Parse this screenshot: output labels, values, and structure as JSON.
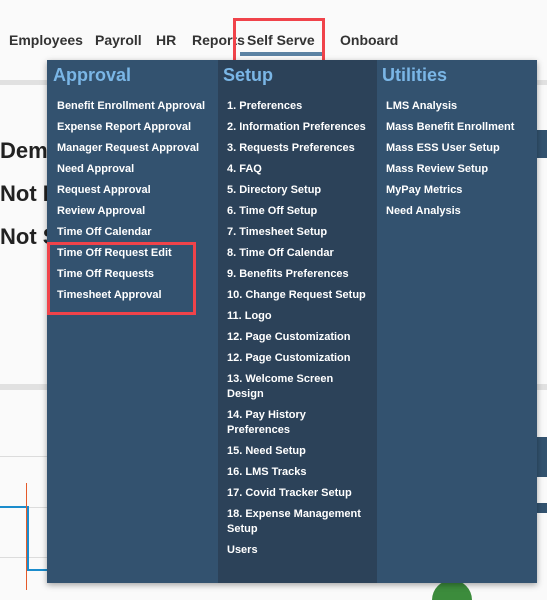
{
  "nav": {
    "items": [
      {
        "label": "Employees"
      },
      {
        "label": "Payroll"
      },
      {
        "label": "HR"
      },
      {
        "label": "Reports"
      },
      {
        "label": "Self Serve",
        "active": true
      },
      {
        "label": "Onboard"
      }
    ]
  },
  "background": {
    "headings": [
      "Demo",
      "Not P",
      "Not S"
    ]
  },
  "menu": {
    "approval": {
      "title": "Approval",
      "items": [
        "Benefit Enrollment Approval",
        "Expense Report Approval",
        "Manager Request Approval",
        "Need Approval",
        "Request Approval",
        "Review Approval",
        "Time Off Calendar",
        "Time Off Request Edit",
        "Time Off Requests",
        "Timesheet Approval"
      ]
    },
    "setup": {
      "title": "Setup",
      "items": [
        "1. Preferences",
        "2. Information Preferences",
        "3. Requests Preferences",
        "4. FAQ",
        "5. Directory Setup",
        "6. Time Off Setup",
        "7. Timesheet Setup",
        "8. Time Off Calendar",
        "9. Benefits Preferences",
        "10. Change Request Setup",
        "11. Logo",
        "12. Page Customization",
        "12. Page Customization",
        "13. Welcome Screen Design",
        "14. Pay History Preferences",
        "15. Need Setup",
        "16. LMS Tracks",
        "17. Covid Tracker Setup",
        "18. Expense Management Setup",
        "Users"
      ]
    },
    "utilities": {
      "title": "Utilities",
      "items": [
        "LMS Analysis",
        "Mass Benefit Enrollment",
        "Mass ESS User Setup",
        "Mass Review Setup",
        "MyPay Metrics",
        "Need Analysis"
      ]
    }
  },
  "colors": {
    "accent_underline": "#5b82a3",
    "highlight_red": "#f0434a",
    "menu_bg": "#33526f",
    "menu_setup_bg": "#2c4259",
    "menu_title": "#7ab6e6"
  }
}
